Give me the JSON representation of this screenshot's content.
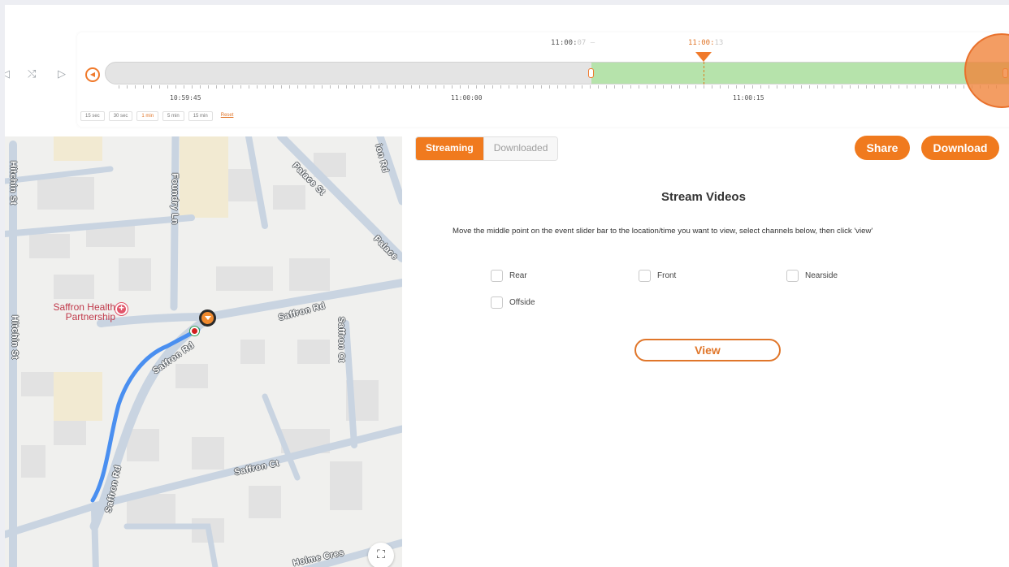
{
  "timeline": {
    "start_label_main": "11:00:",
    "start_label_faint": "07",
    "cursor_label_main": "11:00:",
    "cursor_label_faint": "13",
    "ticks": [
      "10:59:45",
      "11:00:00",
      "11:00:15"
    ],
    "zoom_options": [
      "15 sec",
      "30 sec",
      "1 min",
      "5 min",
      "15 min"
    ],
    "active_zoom": "1 min",
    "reset_label": "Reset"
  },
  "map": {
    "streets": [
      "Hitchin St",
      "Foundry Ln",
      "Palace St",
      "Saffron Rd",
      "Saffron Rd",
      "Saffron Ct",
      "Saffron Rd",
      "Saffron Ct",
      "Hitchin St",
      "Holme Cres",
      "Palace",
      "ion Rd"
    ],
    "poi_name": "Saffron Health Partnership"
  },
  "panel": {
    "tabs": [
      "Streaming",
      "Downloaded"
    ],
    "share_label": "Share",
    "download_label": "Download",
    "title": "Stream Videos",
    "instructions": "Move the middle point on the event slider bar to the location/time you want to view, select channels below, then click 'view'",
    "channels": [
      "Rear",
      "Front",
      "Nearside",
      "Offside"
    ],
    "view_label": "View"
  },
  "colors": {
    "accent": "#f07a1e",
    "track_fill": "#b6e3ab",
    "route": "#4a8ff0",
    "poi": "#c0394a"
  }
}
